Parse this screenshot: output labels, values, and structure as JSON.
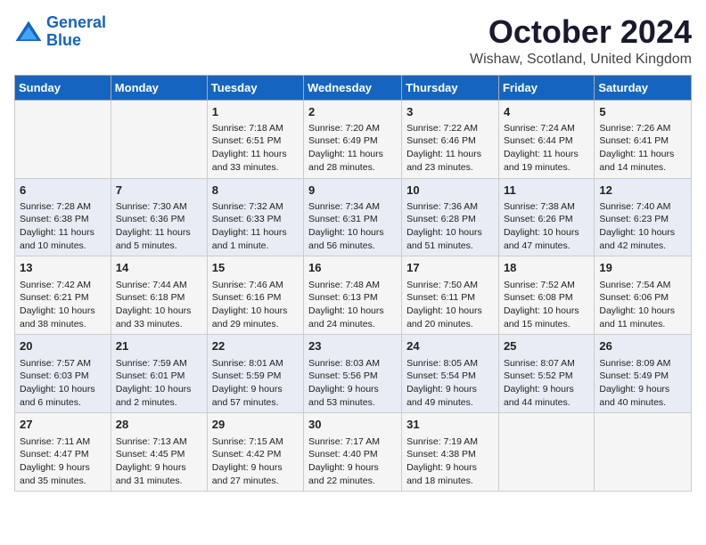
{
  "logo": {
    "line1": "General",
    "line2": "Blue"
  },
  "title": "October 2024",
  "subtitle": "Wishaw, Scotland, United Kingdom",
  "headers": [
    "Sunday",
    "Monday",
    "Tuesday",
    "Wednesday",
    "Thursday",
    "Friday",
    "Saturday"
  ],
  "rows": [
    [
      {
        "day": "",
        "content": ""
      },
      {
        "day": "",
        "content": ""
      },
      {
        "day": "1",
        "content": "Sunrise: 7:18 AM\nSunset: 6:51 PM\nDaylight: 11 hours\nand 33 minutes."
      },
      {
        "day": "2",
        "content": "Sunrise: 7:20 AM\nSunset: 6:49 PM\nDaylight: 11 hours\nand 28 minutes."
      },
      {
        "day": "3",
        "content": "Sunrise: 7:22 AM\nSunset: 6:46 PM\nDaylight: 11 hours\nand 23 minutes."
      },
      {
        "day": "4",
        "content": "Sunrise: 7:24 AM\nSunset: 6:44 PM\nDaylight: 11 hours\nand 19 minutes."
      },
      {
        "day": "5",
        "content": "Sunrise: 7:26 AM\nSunset: 6:41 PM\nDaylight: 11 hours\nand 14 minutes."
      }
    ],
    [
      {
        "day": "6",
        "content": "Sunrise: 7:28 AM\nSunset: 6:38 PM\nDaylight: 11 hours\nand 10 minutes."
      },
      {
        "day": "7",
        "content": "Sunrise: 7:30 AM\nSunset: 6:36 PM\nDaylight: 11 hours\nand 5 minutes."
      },
      {
        "day": "8",
        "content": "Sunrise: 7:32 AM\nSunset: 6:33 PM\nDaylight: 11 hours\nand 1 minute."
      },
      {
        "day": "9",
        "content": "Sunrise: 7:34 AM\nSunset: 6:31 PM\nDaylight: 10 hours\nand 56 minutes."
      },
      {
        "day": "10",
        "content": "Sunrise: 7:36 AM\nSunset: 6:28 PM\nDaylight: 10 hours\nand 51 minutes."
      },
      {
        "day": "11",
        "content": "Sunrise: 7:38 AM\nSunset: 6:26 PM\nDaylight: 10 hours\nand 47 minutes."
      },
      {
        "day": "12",
        "content": "Sunrise: 7:40 AM\nSunset: 6:23 PM\nDaylight: 10 hours\nand 42 minutes."
      }
    ],
    [
      {
        "day": "13",
        "content": "Sunrise: 7:42 AM\nSunset: 6:21 PM\nDaylight: 10 hours\nand 38 minutes."
      },
      {
        "day": "14",
        "content": "Sunrise: 7:44 AM\nSunset: 6:18 PM\nDaylight: 10 hours\nand 33 minutes."
      },
      {
        "day": "15",
        "content": "Sunrise: 7:46 AM\nSunset: 6:16 PM\nDaylight: 10 hours\nand 29 minutes."
      },
      {
        "day": "16",
        "content": "Sunrise: 7:48 AM\nSunset: 6:13 PM\nDaylight: 10 hours\nand 24 minutes."
      },
      {
        "day": "17",
        "content": "Sunrise: 7:50 AM\nSunset: 6:11 PM\nDaylight: 10 hours\nand 20 minutes."
      },
      {
        "day": "18",
        "content": "Sunrise: 7:52 AM\nSunset: 6:08 PM\nDaylight: 10 hours\nand 15 minutes."
      },
      {
        "day": "19",
        "content": "Sunrise: 7:54 AM\nSunset: 6:06 PM\nDaylight: 10 hours\nand 11 minutes."
      }
    ],
    [
      {
        "day": "20",
        "content": "Sunrise: 7:57 AM\nSunset: 6:03 PM\nDaylight: 10 hours\nand 6 minutes."
      },
      {
        "day": "21",
        "content": "Sunrise: 7:59 AM\nSunset: 6:01 PM\nDaylight: 10 hours\nand 2 minutes."
      },
      {
        "day": "22",
        "content": "Sunrise: 8:01 AM\nSunset: 5:59 PM\nDaylight: 9 hours\nand 57 minutes."
      },
      {
        "day": "23",
        "content": "Sunrise: 8:03 AM\nSunset: 5:56 PM\nDaylight: 9 hours\nand 53 minutes."
      },
      {
        "day": "24",
        "content": "Sunrise: 8:05 AM\nSunset: 5:54 PM\nDaylight: 9 hours\nand 49 minutes."
      },
      {
        "day": "25",
        "content": "Sunrise: 8:07 AM\nSunset: 5:52 PM\nDaylight: 9 hours\nand 44 minutes."
      },
      {
        "day": "26",
        "content": "Sunrise: 8:09 AM\nSunset: 5:49 PM\nDaylight: 9 hours\nand 40 minutes."
      }
    ],
    [
      {
        "day": "27",
        "content": "Sunrise: 7:11 AM\nSunset: 4:47 PM\nDaylight: 9 hours\nand 35 minutes."
      },
      {
        "day": "28",
        "content": "Sunrise: 7:13 AM\nSunset: 4:45 PM\nDaylight: 9 hours\nand 31 minutes."
      },
      {
        "day": "29",
        "content": "Sunrise: 7:15 AM\nSunset: 4:42 PM\nDaylight: 9 hours\nand 27 minutes."
      },
      {
        "day": "30",
        "content": "Sunrise: 7:17 AM\nSunset: 4:40 PM\nDaylight: 9 hours\nand 22 minutes."
      },
      {
        "day": "31",
        "content": "Sunrise: 7:19 AM\nSunset: 4:38 PM\nDaylight: 9 hours\nand 18 minutes."
      },
      {
        "day": "",
        "content": ""
      },
      {
        "day": "",
        "content": ""
      }
    ]
  ]
}
